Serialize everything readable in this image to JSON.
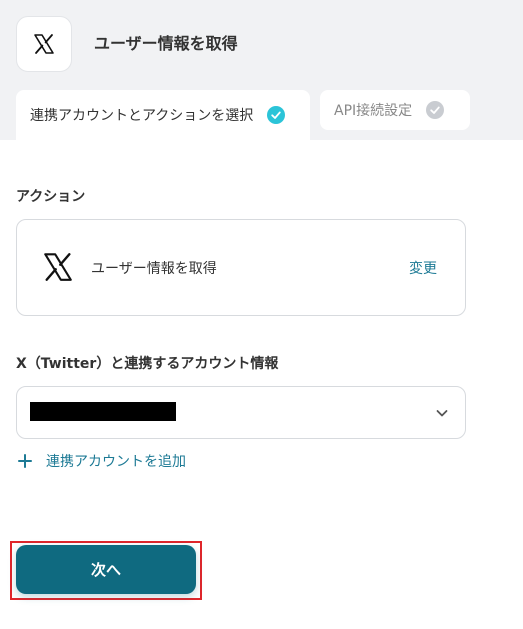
{
  "header": {
    "app_icon": "x-logo-icon",
    "title": "ユーザー情報を取得"
  },
  "tabs": [
    {
      "label": "連携アカウントとアクションを選択",
      "status": "complete",
      "active": true,
      "check_color": "#2bc4d8"
    },
    {
      "label": "API接続設定",
      "status": "pending",
      "active": false,
      "check_color": "#c9ccd1"
    }
  ],
  "action_section": {
    "label": "アクション",
    "action_icon": "x-logo-icon",
    "action_name": "ユーザー情報を取得",
    "change_label": "変更"
  },
  "account_section": {
    "label": "X（Twitter）と連携するアカウント情報",
    "selected_value": "",
    "selected_value_redacted": true,
    "dropdown_icon": "chevron-down-icon",
    "add_account_label": "連携アカウントを追加",
    "add_icon": "plus-icon"
  },
  "footer": {
    "next_label": "次へ"
  },
  "colors": {
    "accent": "#1d7a95",
    "primary_button": "#0f6a80",
    "highlight_border": "#e0262b",
    "header_background": "#f1f2f4"
  }
}
